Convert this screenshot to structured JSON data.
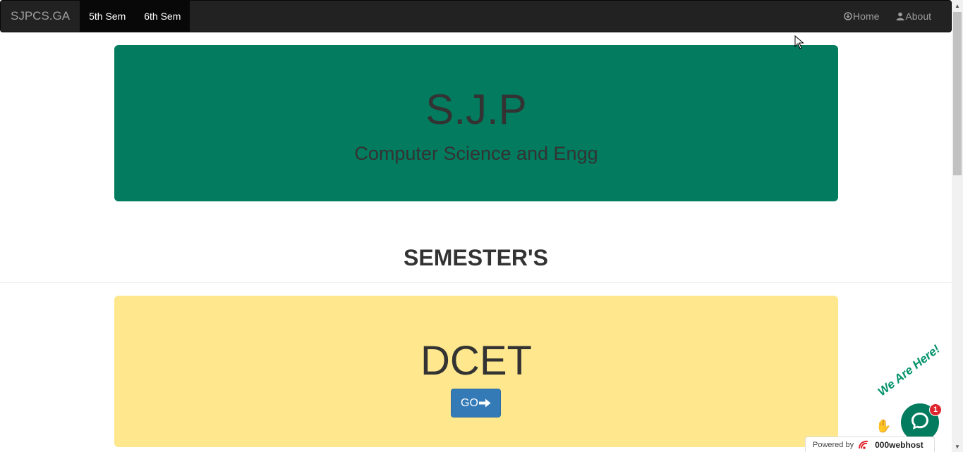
{
  "navbar": {
    "brand": "SJPCS.GA",
    "left_links": [
      "5th Sem",
      "6th Sem"
    ],
    "right_links": [
      {
        "label": "Home",
        "icon": "download-circle-icon"
      },
      {
        "label": "About",
        "icon": "user-icon"
      }
    ]
  },
  "jumbotron": {
    "title": "S.J.P",
    "subtitle": "Computer Science and Engg",
    "color": "#027b5e"
  },
  "section": {
    "title": "SEMESTER'S"
  },
  "card": {
    "title": "DCET",
    "button_label": "GO",
    "button_icon": "arrow-right-icon",
    "color": "#fee78c"
  },
  "chat_widget": {
    "banner": "We Are Here!",
    "badge_count": "1"
  },
  "footer_badge": {
    "prefix": "Powered by",
    "host": "000webhost"
  }
}
